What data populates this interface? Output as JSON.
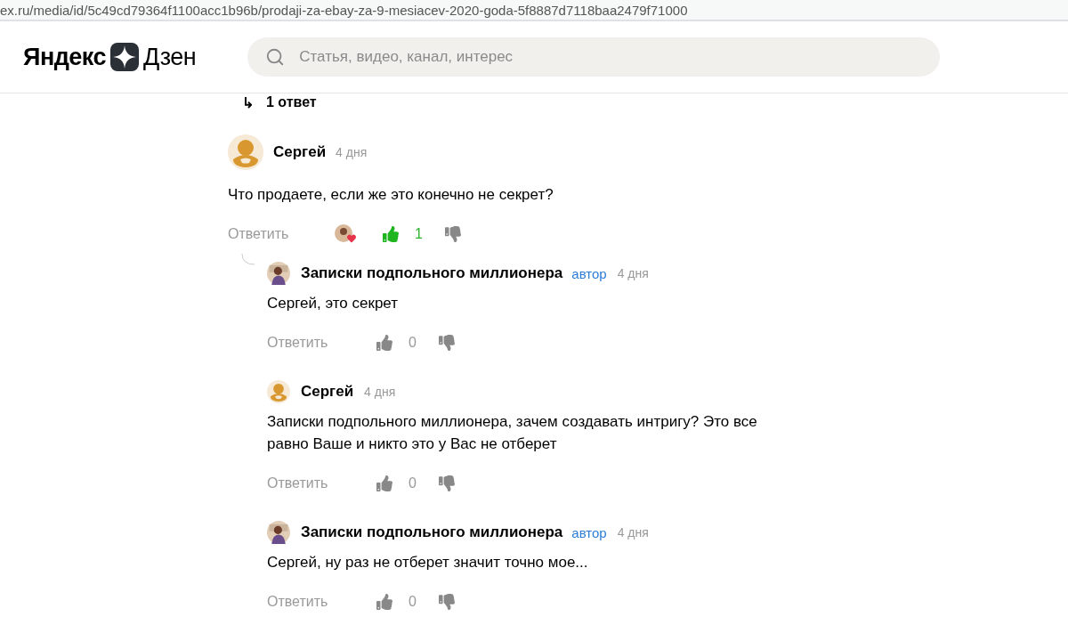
{
  "url_bar": {
    "url": "ex.ru/media/id/5c49cd79364f1100acc1b96b/prodaji-za-ebay-za-9-mesiacev-2020-goda-5f8887d7118baa2479f71000"
  },
  "header": {
    "logo": {
      "brand": "Яндекс",
      "product": "Дзен"
    },
    "search": {
      "placeholder": "Статья, видео, канал, интерес"
    }
  },
  "thread_toggle": {
    "icon": "↳",
    "label": "1 ответ"
  },
  "comment": {
    "avatar": {
      "kind": "mascot"
    },
    "author": "Сергей",
    "time": "4 дня",
    "text": "Что продаете, если же это конечно не секрет?",
    "reply_label": "Ответить",
    "reactions": true,
    "liked": true,
    "likes": "1",
    "replies": [
      {
        "avatar": {
          "kind": "photo"
        },
        "author": "Записки подпольного миллионера",
        "badge": "автор",
        "time": "4 дня",
        "text": "Сергей, это секрет",
        "reply_label": "Ответить",
        "liked": false,
        "likes": "0"
      },
      {
        "avatar": {
          "kind": "mascot"
        },
        "author": "Сергей",
        "time": "4 дня",
        "text": "Записки подпольного миллионера, зачем создавать интригу? Это все равно Ваше и никто это у Вас не отберет",
        "reply_label": "Ответить",
        "liked": false,
        "likes": "0"
      },
      {
        "avatar": {
          "kind": "photo"
        },
        "author": "Записки подпольного миллионера",
        "badge": "автор",
        "time": "4 дня",
        "text": "Сергей, ну раз не отберет значит точно мое...",
        "reply_label": "Ответить",
        "liked": false,
        "likes": "0"
      }
    ]
  }
}
